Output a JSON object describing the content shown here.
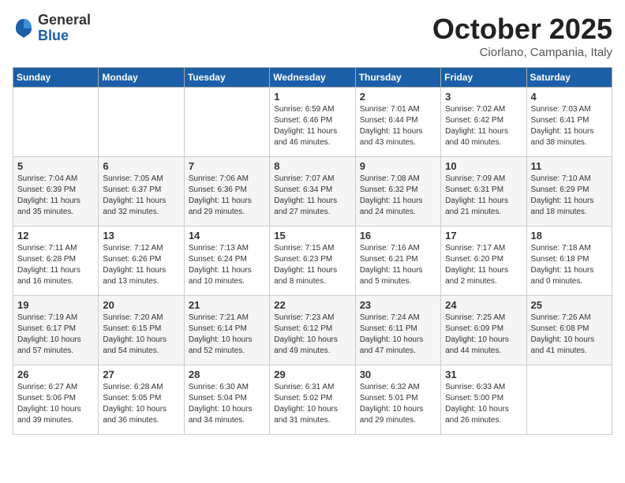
{
  "logo": {
    "general": "General",
    "blue": "Blue"
  },
  "title": "October 2025",
  "location": "Ciorlano, Campania, Italy",
  "days_of_week": [
    "Sunday",
    "Monday",
    "Tuesday",
    "Wednesday",
    "Thursday",
    "Friday",
    "Saturday"
  ],
  "weeks": [
    [
      {
        "day": "",
        "detail": ""
      },
      {
        "day": "",
        "detail": ""
      },
      {
        "day": "",
        "detail": ""
      },
      {
        "day": "1",
        "detail": "Sunrise: 6:59 AM\nSunset: 6:46 PM\nDaylight: 11 hours\nand 46 minutes."
      },
      {
        "day": "2",
        "detail": "Sunrise: 7:01 AM\nSunset: 6:44 PM\nDaylight: 11 hours\nand 43 minutes."
      },
      {
        "day": "3",
        "detail": "Sunrise: 7:02 AM\nSunset: 6:42 PM\nDaylight: 11 hours\nand 40 minutes."
      },
      {
        "day": "4",
        "detail": "Sunrise: 7:03 AM\nSunset: 6:41 PM\nDaylight: 11 hours\nand 38 minutes."
      }
    ],
    [
      {
        "day": "5",
        "detail": "Sunrise: 7:04 AM\nSunset: 6:39 PM\nDaylight: 11 hours\nand 35 minutes."
      },
      {
        "day": "6",
        "detail": "Sunrise: 7:05 AM\nSunset: 6:37 PM\nDaylight: 11 hours\nand 32 minutes."
      },
      {
        "day": "7",
        "detail": "Sunrise: 7:06 AM\nSunset: 6:36 PM\nDaylight: 11 hours\nand 29 minutes."
      },
      {
        "day": "8",
        "detail": "Sunrise: 7:07 AM\nSunset: 6:34 PM\nDaylight: 11 hours\nand 27 minutes."
      },
      {
        "day": "9",
        "detail": "Sunrise: 7:08 AM\nSunset: 6:32 PM\nDaylight: 11 hours\nand 24 minutes."
      },
      {
        "day": "10",
        "detail": "Sunrise: 7:09 AM\nSunset: 6:31 PM\nDaylight: 11 hours\nand 21 minutes."
      },
      {
        "day": "11",
        "detail": "Sunrise: 7:10 AM\nSunset: 6:29 PM\nDaylight: 11 hours\nand 18 minutes."
      }
    ],
    [
      {
        "day": "12",
        "detail": "Sunrise: 7:11 AM\nSunset: 6:28 PM\nDaylight: 11 hours\nand 16 minutes."
      },
      {
        "day": "13",
        "detail": "Sunrise: 7:12 AM\nSunset: 6:26 PM\nDaylight: 11 hours\nand 13 minutes."
      },
      {
        "day": "14",
        "detail": "Sunrise: 7:13 AM\nSunset: 6:24 PM\nDaylight: 11 hours\nand 10 minutes."
      },
      {
        "day": "15",
        "detail": "Sunrise: 7:15 AM\nSunset: 6:23 PM\nDaylight: 11 hours\nand 8 minutes."
      },
      {
        "day": "16",
        "detail": "Sunrise: 7:16 AM\nSunset: 6:21 PM\nDaylight: 11 hours\nand 5 minutes."
      },
      {
        "day": "17",
        "detail": "Sunrise: 7:17 AM\nSunset: 6:20 PM\nDaylight: 11 hours\nand 2 minutes."
      },
      {
        "day": "18",
        "detail": "Sunrise: 7:18 AM\nSunset: 6:18 PM\nDaylight: 11 hours\nand 0 minutes."
      }
    ],
    [
      {
        "day": "19",
        "detail": "Sunrise: 7:19 AM\nSunset: 6:17 PM\nDaylight: 10 hours\nand 57 minutes."
      },
      {
        "day": "20",
        "detail": "Sunrise: 7:20 AM\nSunset: 6:15 PM\nDaylight: 10 hours\nand 54 minutes."
      },
      {
        "day": "21",
        "detail": "Sunrise: 7:21 AM\nSunset: 6:14 PM\nDaylight: 10 hours\nand 52 minutes."
      },
      {
        "day": "22",
        "detail": "Sunrise: 7:23 AM\nSunset: 6:12 PM\nDaylight: 10 hours\nand 49 minutes."
      },
      {
        "day": "23",
        "detail": "Sunrise: 7:24 AM\nSunset: 6:11 PM\nDaylight: 10 hours\nand 47 minutes."
      },
      {
        "day": "24",
        "detail": "Sunrise: 7:25 AM\nSunset: 6:09 PM\nDaylight: 10 hours\nand 44 minutes."
      },
      {
        "day": "25",
        "detail": "Sunrise: 7:26 AM\nSunset: 6:08 PM\nDaylight: 10 hours\nand 41 minutes."
      }
    ],
    [
      {
        "day": "26",
        "detail": "Sunrise: 6:27 AM\nSunset: 5:06 PM\nDaylight: 10 hours\nand 39 minutes."
      },
      {
        "day": "27",
        "detail": "Sunrise: 6:28 AM\nSunset: 5:05 PM\nDaylight: 10 hours\nand 36 minutes."
      },
      {
        "day": "28",
        "detail": "Sunrise: 6:30 AM\nSunset: 5:04 PM\nDaylight: 10 hours\nand 34 minutes."
      },
      {
        "day": "29",
        "detail": "Sunrise: 6:31 AM\nSunset: 5:02 PM\nDaylight: 10 hours\nand 31 minutes."
      },
      {
        "day": "30",
        "detail": "Sunrise: 6:32 AM\nSunset: 5:01 PM\nDaylight: 10 hours\nand 29 minutes."
      },
      {
        "day": "31",
        "detail": "Sunrise: 6:33 AM\nSunset: 5:00 PM\nDaylight: 10 hours\nand 26 minutes."
      },
      {
        "day": "",
        "detail": ""
      }
    ]
  ]
}
